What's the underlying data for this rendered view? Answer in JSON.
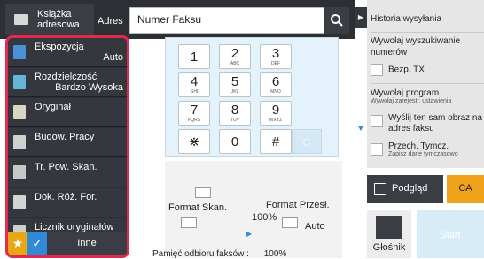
{
  "header": {
    "address_book_label": "Książka adresowa",
    "address_label": "Adres",
    "fax_number_placeholder": "Numer Faksu"
  },
  "left_panel": {
    "items": [
      {
        "label": "Ekspozycja",
        "value": "Auto"
      },
      {
        "label": "Rozdzielczość",
        "value": "Bardzo Wysoka"
      },
      {
        "label": "Oryginał",
        "value": ""
      },
      {
        "label": "Budow. Pracy",
        "value": ""
      },
      {
        "label": "Tr. Pow. Skan.",
        "value": ""
      },
      {
        "label": "Dok. Róż. For.",
        "value": ""
      },
      {
        "label": "Licznik oryginałów",
        "value": ""
      }
    ],
    "other_label": "Inne"
  },
  "keypad": {
    "keys": [
      {
        "digit": "1",
        "sub": ""
      },
      {
        "digit": "2",
        "sub": "ABC"
      },
      {
        "digit": "3",
        "sub": "DEF"
      },
      {
        "digit": "4",
        "sub": "GHI"
      },
      {
        "digit": "5",
        "sub": "JKL"
      },
      {
        "digit": "6",
        "sub": "MNO"
      },
      {
        "digit": "7",
        "sub": "PQRS"
      },
      {
        "digit": "8",
        "sub": "TUV"
      },
      {
        "digit": "9",
        "sub": "WXYZ"
      },
      {
        "digit": "⋇",
        "sub": ""
      },
      {
        "digit": "0",
        "sub": ""
      },
      {
        "digit": "#",
        "sub": ""
      }
    ],
    "clear_label": "C"
  },
  "format": {
    "scan_label": "Format Skan.",
    "send_label": "Format Przesł.",
    "ratio": "100%",
    "send_value": "Auto",
    "memory_label": "Pamięć odbioru faksów :",
    "memory_value": "100%"
  },
  "right_panel": {
    "history_label": "Historia wysyłania",
    "call_search_label": "Wywołaj wyszukiwanie numerów",
    "bezp_tx_label": "Bezp. TX",
    "call_program_label": "Wywołaj program",
    "call_program_sub": "Wywołaj zarejestr. ustawienia",
    "resend_label": "Wyślij ten sam obraz na adres faksu",
    "przech_label": "Przech. Tymcz.",
    "przech_sub": "Zapisz dane tymczasowo"
  },
  "actions": {
    "preview_label": "Podgląd",
    "ca_label": "CA",
    "speaker_label": "Głośnik",
    "start_label": "Start"
  },
  "colors": {
    "highlight_border": "#e22a4f",
    "accent_orange": "#f0a21a",
    "star_yellow": "#e8a814",
    "check_blue": "#2f8bd8"
  }
}
